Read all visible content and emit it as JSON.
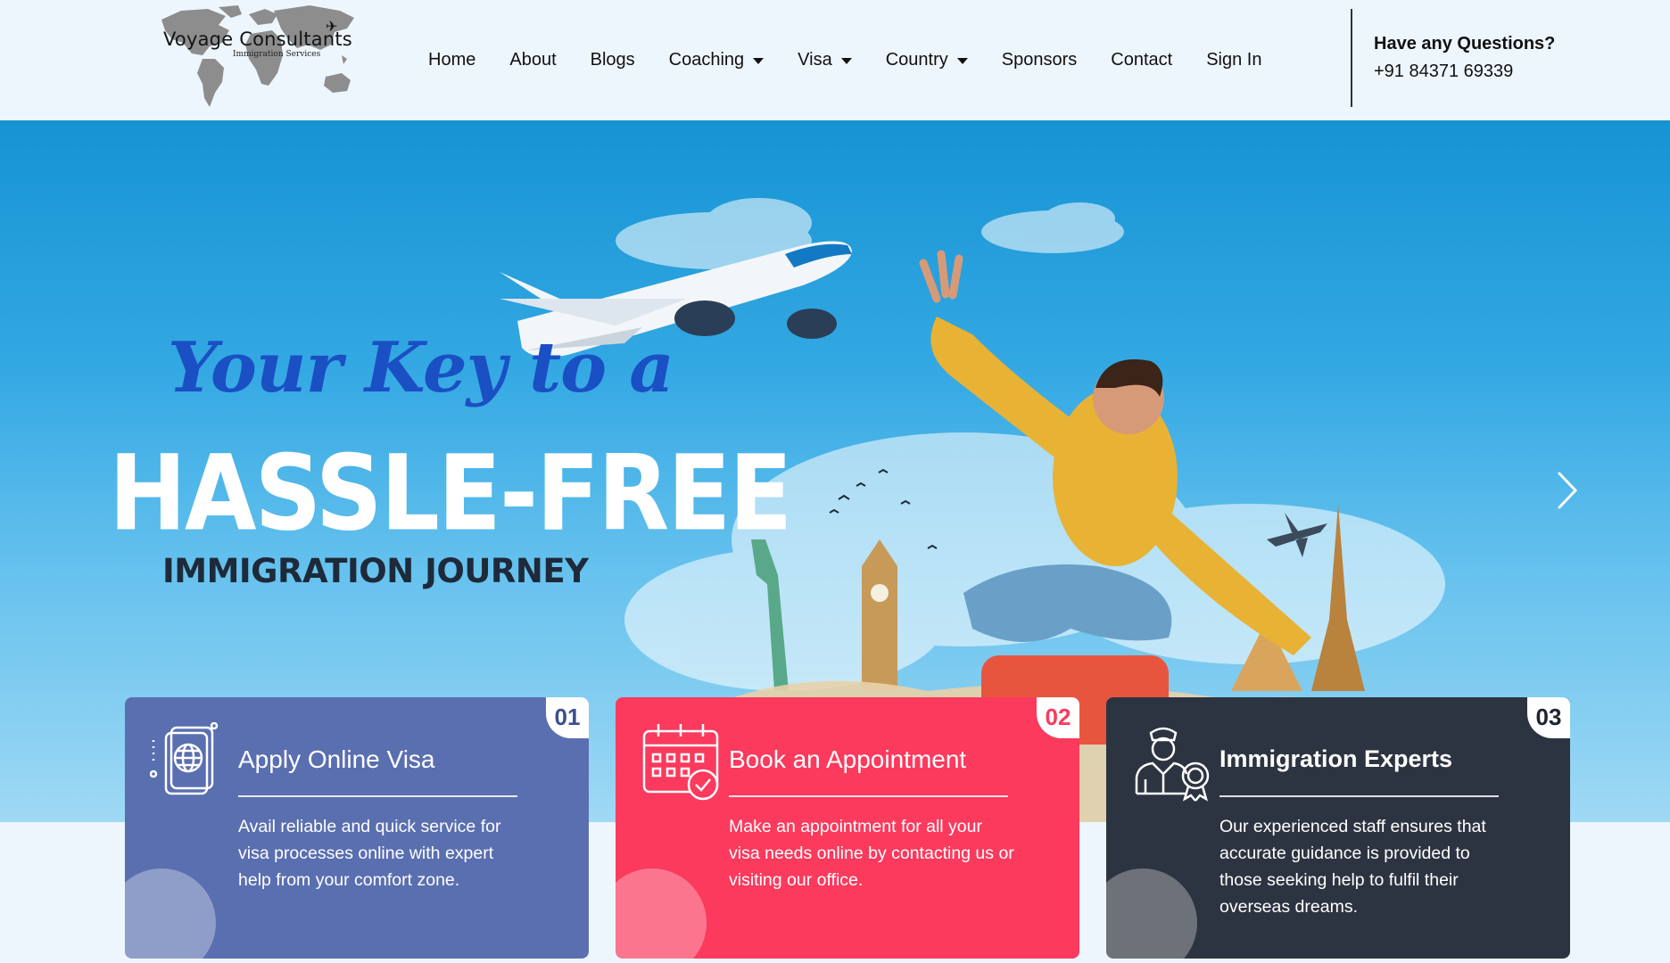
{
  "brand": {
    "name": "Voyage Consultants",
    "tagline": "Immigration Services"
  },
  "nav": {
    "home": "Home",
    "about": "About",
    "blogs": "Blogs",
    "coaching": "Coaching",
    "visa": "Visa",
    "country": "Country",
    "sponsors": "Sponsors",
    "contact": "Contact",
    "signin": "Sign In"
  },
  "contact": {
    "question": "Have any Questions?",
    "phone": "+91 84371 69339"
  },
  "hero": {
    "script_line": "Your Key to a",
    "headline": "HASSLE-FREE",
    "subline": "IMMIGRATION JOURNEY",
    "next_icon": "chevron-right-icon"
  },
  "cards": [
    {
      "number": "01",
      "title": "Apply Online Visa",
      "text": "Avail reliable and quick service for visa processes online with expert help from your comfort zone.",
      "icon": "passport-globe-icon",
      "color": "#5a6fb0"
    },
    {
      "number": "02",
      "title": "Book an Appointment",
      "text": "Make an appointment for all your visa needs online by contacting us or visiting our office.",
      "icon": "calendar-check-icon",
      "color": "#fb3a5d"
    },
    {
      "number": "03",
      "title": "Immigration Experts",
      "text": "Our experienced staff ensures that accurate guidance is provided to those seeking help to fulfil their overseas dreams.",
      "icon": "expert-badge-icon",
      "color": "#2d3441"
    }
  ]
}
